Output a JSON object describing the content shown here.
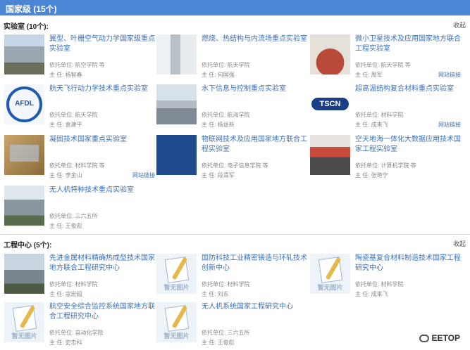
{
  "header": {
    "title": "国家级 (15个)"
  },
  "labs": {
    "section_label": "实验室 (10个):",
    "collapse_label": "收起",
    "items": [
      {
        "name": "翼型、叶栅空气动力学国家级重点实验室",
        "unit": "依托单位:    航空学院 等",
        "head": "主      任:    杨智春",
        "link": "",
        "thumb": "photo"
      },
      {
        "name": "燃烧、热结构与内流场重点实验室",
        "unit": "依托单位:    航天学院",
        "head": "主      任:    何国强",
        "link": "",
        "thumb": "photo"
      },
      {
        "name": "微小卫星技术及应用国家地方联合工程实验室",
        "unit": "依托单位:    航天学院 等",
        "head": "主      任:    周军",
        "link": "网站链接",
        "thumb": "photo"
      },
      {
        "name": "航天飞行动力学技术重点实验室",
        "unit": "依托单位:    航天学院",
        "head": "主      任:    袁建平",
        "link": "",
        "thumb": "logo",
        "logo_text": "AFDL"
      },
      {
        "name": "水下信息与控制重点实验室",
        "unit": "依托单位:    航海学院",
        "head": "主      任:    杨益新",
        "link": "",
        "thumb": "photo"
      },
      {
        "name": "超高温结构复合材料重点实验室",
        "unit": "依托单位:    材料学院",
        "head": "主      任:    成来飞",
        "link": "网站链接",
        "thumb": "logo",
        "logo_text": "TSCN"
      },
      {
        "name": "凝固技术国家重点实验室",
        "unit": "依托单位:    材料学院 等",
        "head": "主      任:    李金山",
        "link": "网站链接",
        "thumb": "photo"
      },
      {
        "name": "物联网技术及应用国家地方联合工程实验室",
        "unit": "依托单位:    电子信息学院 等",
        "head": "主      任:    段渭军",
        "link": "",
        "thumb": "photo"
      },
      {
        "name": "空天地海一体化大数据应用技术国家工程实验室",
        "unit": "依托单位:    计算机学院 等",
        "head": "主      任:    张艳宁",
        "link": "",
        "thumb": "photo"
      },
      {
        "name": "无人机特种技术重点实验室",
        "unit": "依托单位:    三六五所",
        "head": "主      任:    王俊彪",
        "link": "",
        "thumb": "photo"
      }
    ]
  },
  "centers": {
    "section_label": "工程中心 (5个):",
    "collapse_label": "收起",
    "placeholder_text": "暂无图片",
    "items": [
      {
        "name": "先进金属材料精确热成型技术国家地方联合工程研究中心",
        "unit": "依托单位:    材料学院",
        "head": "主      任:    寇宏超",
        "thumb": "photo"
      },
      {
        "name": "国防科技工业精密锻造与环轧技术创新中心",
        "unit": "依托单位:    材料学院",
        "head": "主      任:    刘东",
        "thumb": "placeholder"
      },
      {
        "name": "陶瓷基复合材料制造技术国家工程研究中心",
        "unit": "依托单位:    材料学院",
        "head": "主      任:    成来飞",
        "thumb": "placeholder"
      },
      {
        "name": "航空安全综合监控系统国家地方联合工程研究中心",
        "unit": "依托单位:    自动化学院",
        "head": "主      任:    史忠科",
        "thumb": "placeholder"
      },
      {
        "name": "无人机系统国家工程研究中心",
        "unit": "依托单位:    三六五所",
        "head": "主      任:    王俊彪",
        "thumb": "placeholder"
      }
    ]
  },
  "watermark": {
    "text": "EETOP"
  },
  "colors": {
    "header_bg": "#4a86d4",
    "link": "#3a6fb8",
    "meta": "#888888"
  }
}
